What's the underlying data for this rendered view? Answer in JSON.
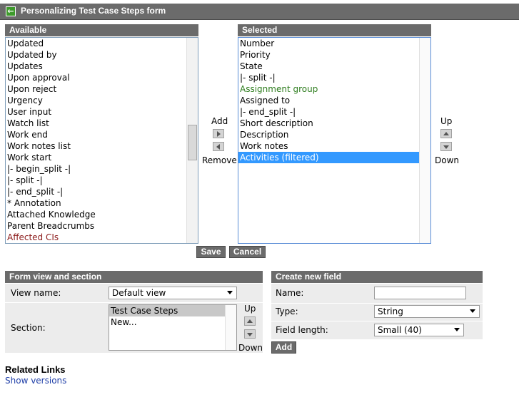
{
  "title": "Personalizing Test Case Steps form",
  "available": {
    "header": "Available",
    "items": [
      "Updated",
      "Updated by",
      "Updates",
      "Upon approval",
      "Upon reject",
      "Urgency",
      "User input",
      "Watch list",
      "Work end",
      "Work notes list",
      "Work start",
      "|- begin_split -|",
      "|- split -|",
      "|- end_split -|",
      "* Annotation",
      "Attached Knowledge",
      "Parent Breadcrumbs",
      "Affected CIs"
    ]
  },
  "selected": {
    "header": "Selected",
    "items": [
      "Number",
      "Priority",
      "State",
      "|- split -|",
      "Assignment group",
      "Assigned to",
      "|- end_split -|",
      "Short description",
      "Description",
      "Work notes",
      "Activities (filtered)"
    ]
  },
  "controls": {
    "add_label": "Add",
    "remove_label": "Remove",
    "up_label": "Up",
    "down_label": "Down",
    "save_label": "Save",
    "cancel_label": "Cancel"
  },
  "form_view": {
    "header": "Form view and section",
    "view_name_label": "View name:",
    "view_name_value": "Default view",
    "section_label": "Section:",
    "sections": [
      "Test Case Steps",
      "New..."
    ],
    "up_label": "Up",
    "down_label": "Down"
  },
  "new_field": {
    "header": "Create new field",
    "name_label": "Name:",
    "name_value": "",
    "type_label": "Type:",
    "type_value": "String",
    "length_label": "Field length:",
    "length_value": "Small (40)",
    "add_label": "Add"
  },
  "related": {
    "heading": "Related Links",
    "show_versions": "Show versions"
  },
  "colors": {
    "header_bg": "#6b6b6b",
    "selection": "#3399ff",
    "green_text": "#2e7d1e",
    "maroon_text": "#8b1a1a",
    "link": "#1f3fa8"
  }
}
